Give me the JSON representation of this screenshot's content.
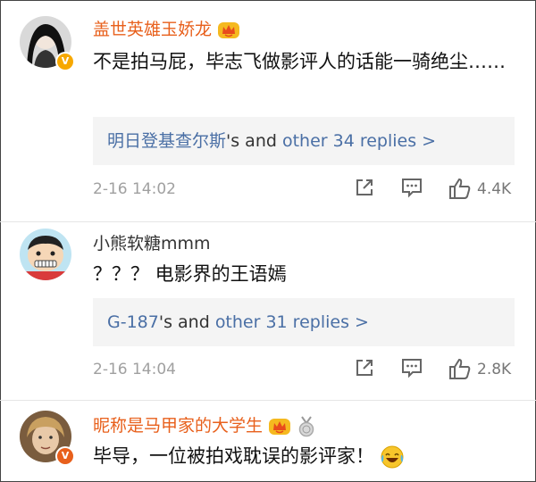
{
  "comments": [
    {
      "username": "盖世英雄玉娇龙",
      "text": "不是拍马屁，毕志飞做影评人的话能一骑绝尘……",
      "replies": {
        "first_user": "明日登基查尔斯",
        "mid": "'s and ",
        "other": "other 34 replies >"
      },
      "time": "2-16 14:02",
      "likes": "4.4K"
    },
    {
      "username": "小熊软糖mmm",
      "text": "？？？ 电影界的王语嫣",
      "replies": {
        "first_user": "G-187",
        "mid": "'s and ",
        "other": "other 31 replies >"
      },
      "time": "2-16 14:04",
      "likes": "2.8K"
    },
    {
      "username": "昵称是马甲家的大学生",
      "text": "毕导，一位被拍戏耽误的影评家！"
    }
  ],
  "colors": {
    "vip_name": "#e8601c",
    "reply_link": "#4a6fa5",
    "reply_bg": "#f4f4f4",
    "meta_gray": "#a0a0a0",
    "verified_badge": "#f7a800"
  },
  "icons": [
    "crown-vip-icon",
    "share-icon",
    "comment-icon",
    "like-icon",
    "verified-badge-icon",
    "medal-icon",
    "laugh-cry-emoji"
  ]
}
